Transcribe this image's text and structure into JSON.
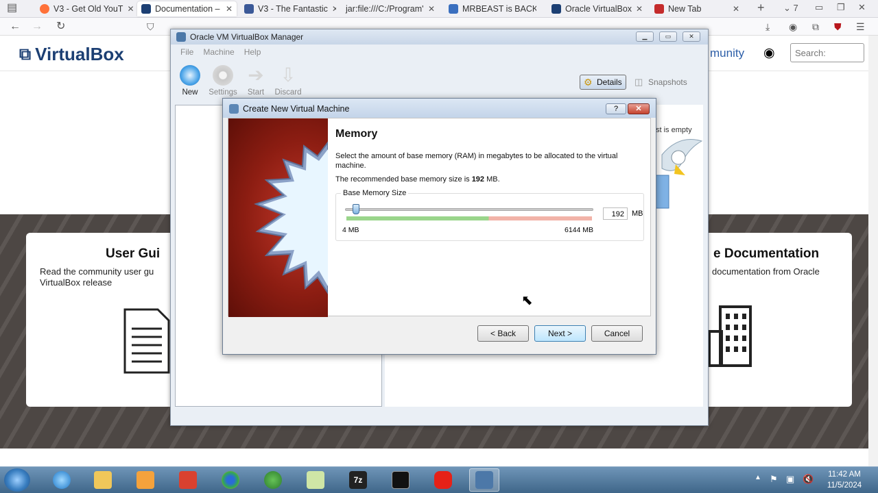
{
  "browser": {
    "tabs": [
      {
        "label": "V3 - Get Old YouT",
        "color": "#ff7139"
      },
      {
        "label": "Documentation – ",
        "color": "#1c3f73"
      },
      {
        "label": "V3 - The Fantastic",
        "color": "#3b5998"
      },
      {
        "label": "jar:file:///C:/Program'",
        "color": "#999999"
      },
      {
        "label": "MRBEAST is BACK",
        "color": "#3a6fbf"
      },
      {
        "label": "Oracle VirtualBox",
        "color": "#1c3f73"
      },
      {
        "label": "New Tab",
        "color": "#c42b2b"
      }
    ],
    "tab_count": "7"
  },
  "site": {
    "logo": "VirtualBox",
    "community": "munity",
    "search_placeholder": "Search:",
    "card1_title": "User Gui",
    "card1_text": "Read the community user gu VirtualBox release",
    "card2_title": "e Documentation",
    "card2_text": "documentation from Oracle"
  },
  "manager": {
    "title": "Oracle VM VirtualBox Manager",
    "menu": [
      "File",
      "Machine",
      "Help"
    ],
    "tools": [
      "New",
      "Settings",
      "Start",
      "Discard"
    ],
    "details": "Details",
    "snapshots": "Snapshots",
    "empty": "st is empty"
  },
  "dialog": {
    "title": "Create New Virtual Machine",
    "help": "?",
    "heading": "Memory",
    "desc": "Select the amount of base memory (RAM) in megabytes to be allocated to the virtual machine.",
    "recommended_prefix": "The recommended base memory size is ",
    "recommended_value": "192",
    "recommended_suffix": " MB.",
    "group_label": "Base Memory Size",
    "memory_value": "192",
    "unit": "MB",
    "min_label": "4 MB",
    "max_label": "6144 MB",
    "slider_fraction": 0.031,
    "back": "< Back",
    "next": "Next >",
    "cancel": "Cancel"
  },
  "taskbar": {
    "time": "11:42 AM",
    "date": "11/5/2024",
    "apps": [
      "internet-explorer",
      "file-explorer",
      "media-player",
      "gmail",
      "chrome",
      "ccleaner",
      "notepad",
      "7zip",
      "command-prompt",
      "youtube",
      "virtualbox"
    ]
  }
}
